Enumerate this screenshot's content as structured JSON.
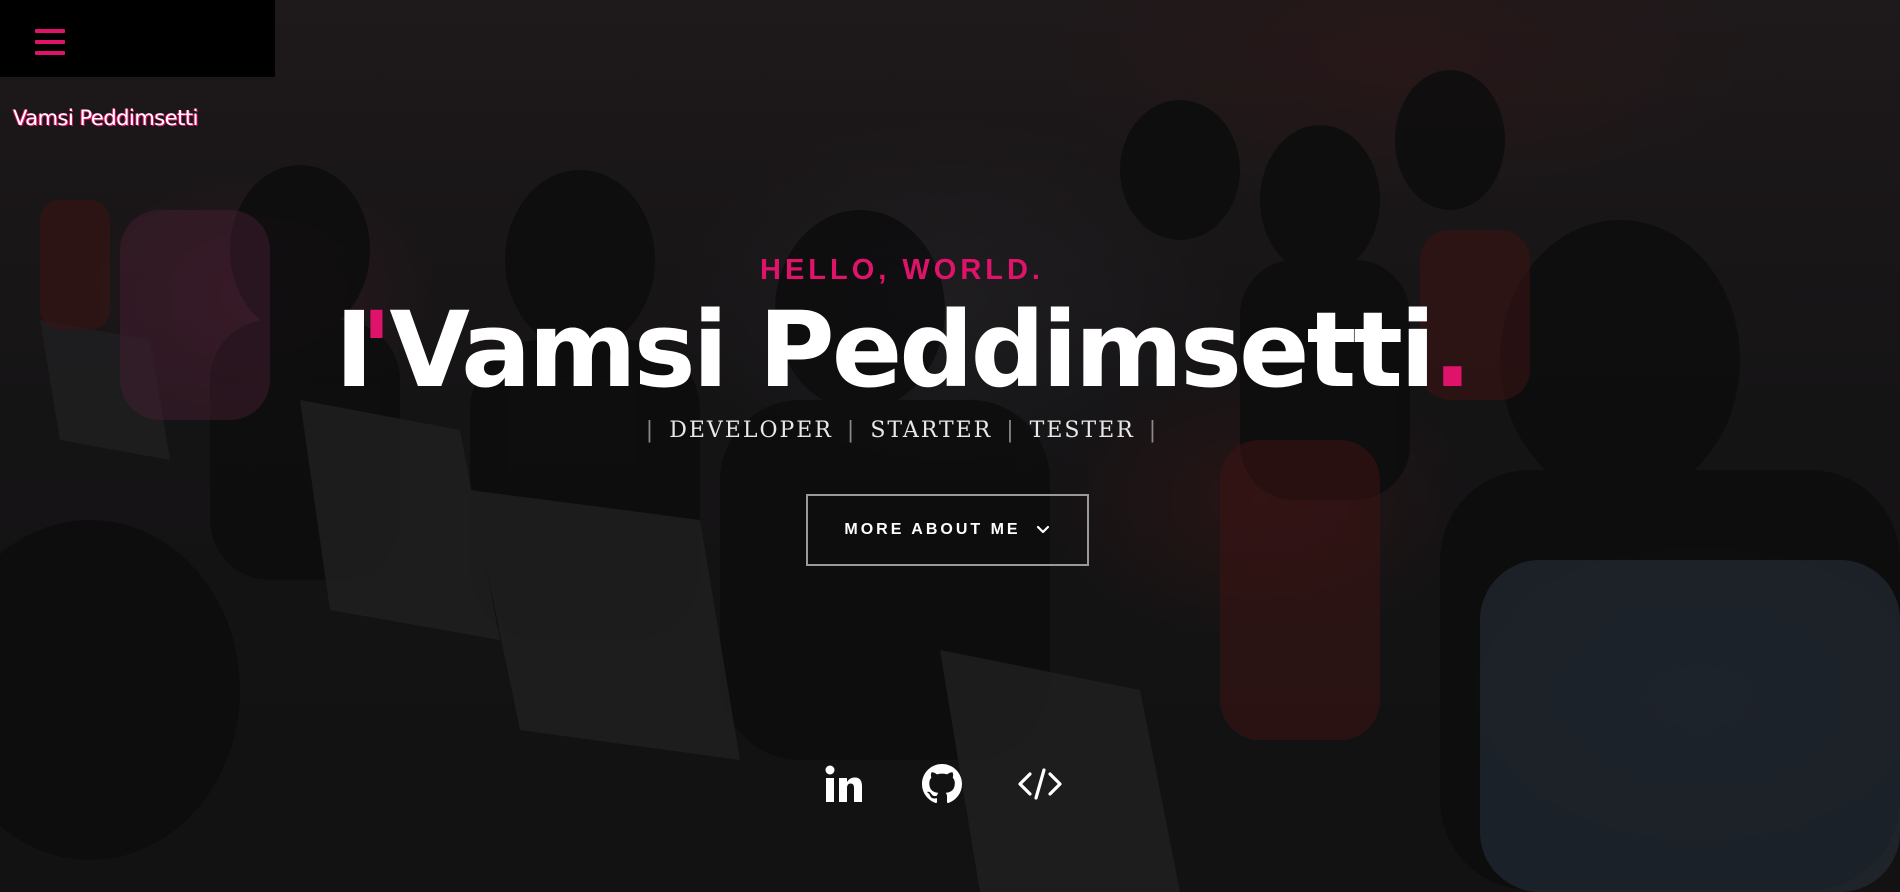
{
  "header": {
    "menu_icon": "hamburger-menu-icon",
    "site_name": "Vamsi Peddimsetti"
  },
  "hero": {
    "kicker": "HELLO, WORLD.",
    "title_prefix": "I",
    "title_apostrophe": "'",
    "title_name": "Vamsi Peddimsetti",
    "title_period": ".",
    "roles": [
      "DEVELOPER",
      "STARTER",
      "TESTER"
    ],
    "role_separator": "|",
    "cta_label": "MORE ABOUT ME",
    "cta_icon": "chevron-down-icon"
  },
  "socials": [
    {
      "name": "linkedin-icon"
    },
    {
      "name": "github-icon"
    },
    {
      "name": "code-icon"
    }
  ],
  "colors": {
    "accent": "#e0136b",
    "menu_background": "#000000",
    "text": "#ffffff",
    "button_border": "#9a9a9a"
  }
}
